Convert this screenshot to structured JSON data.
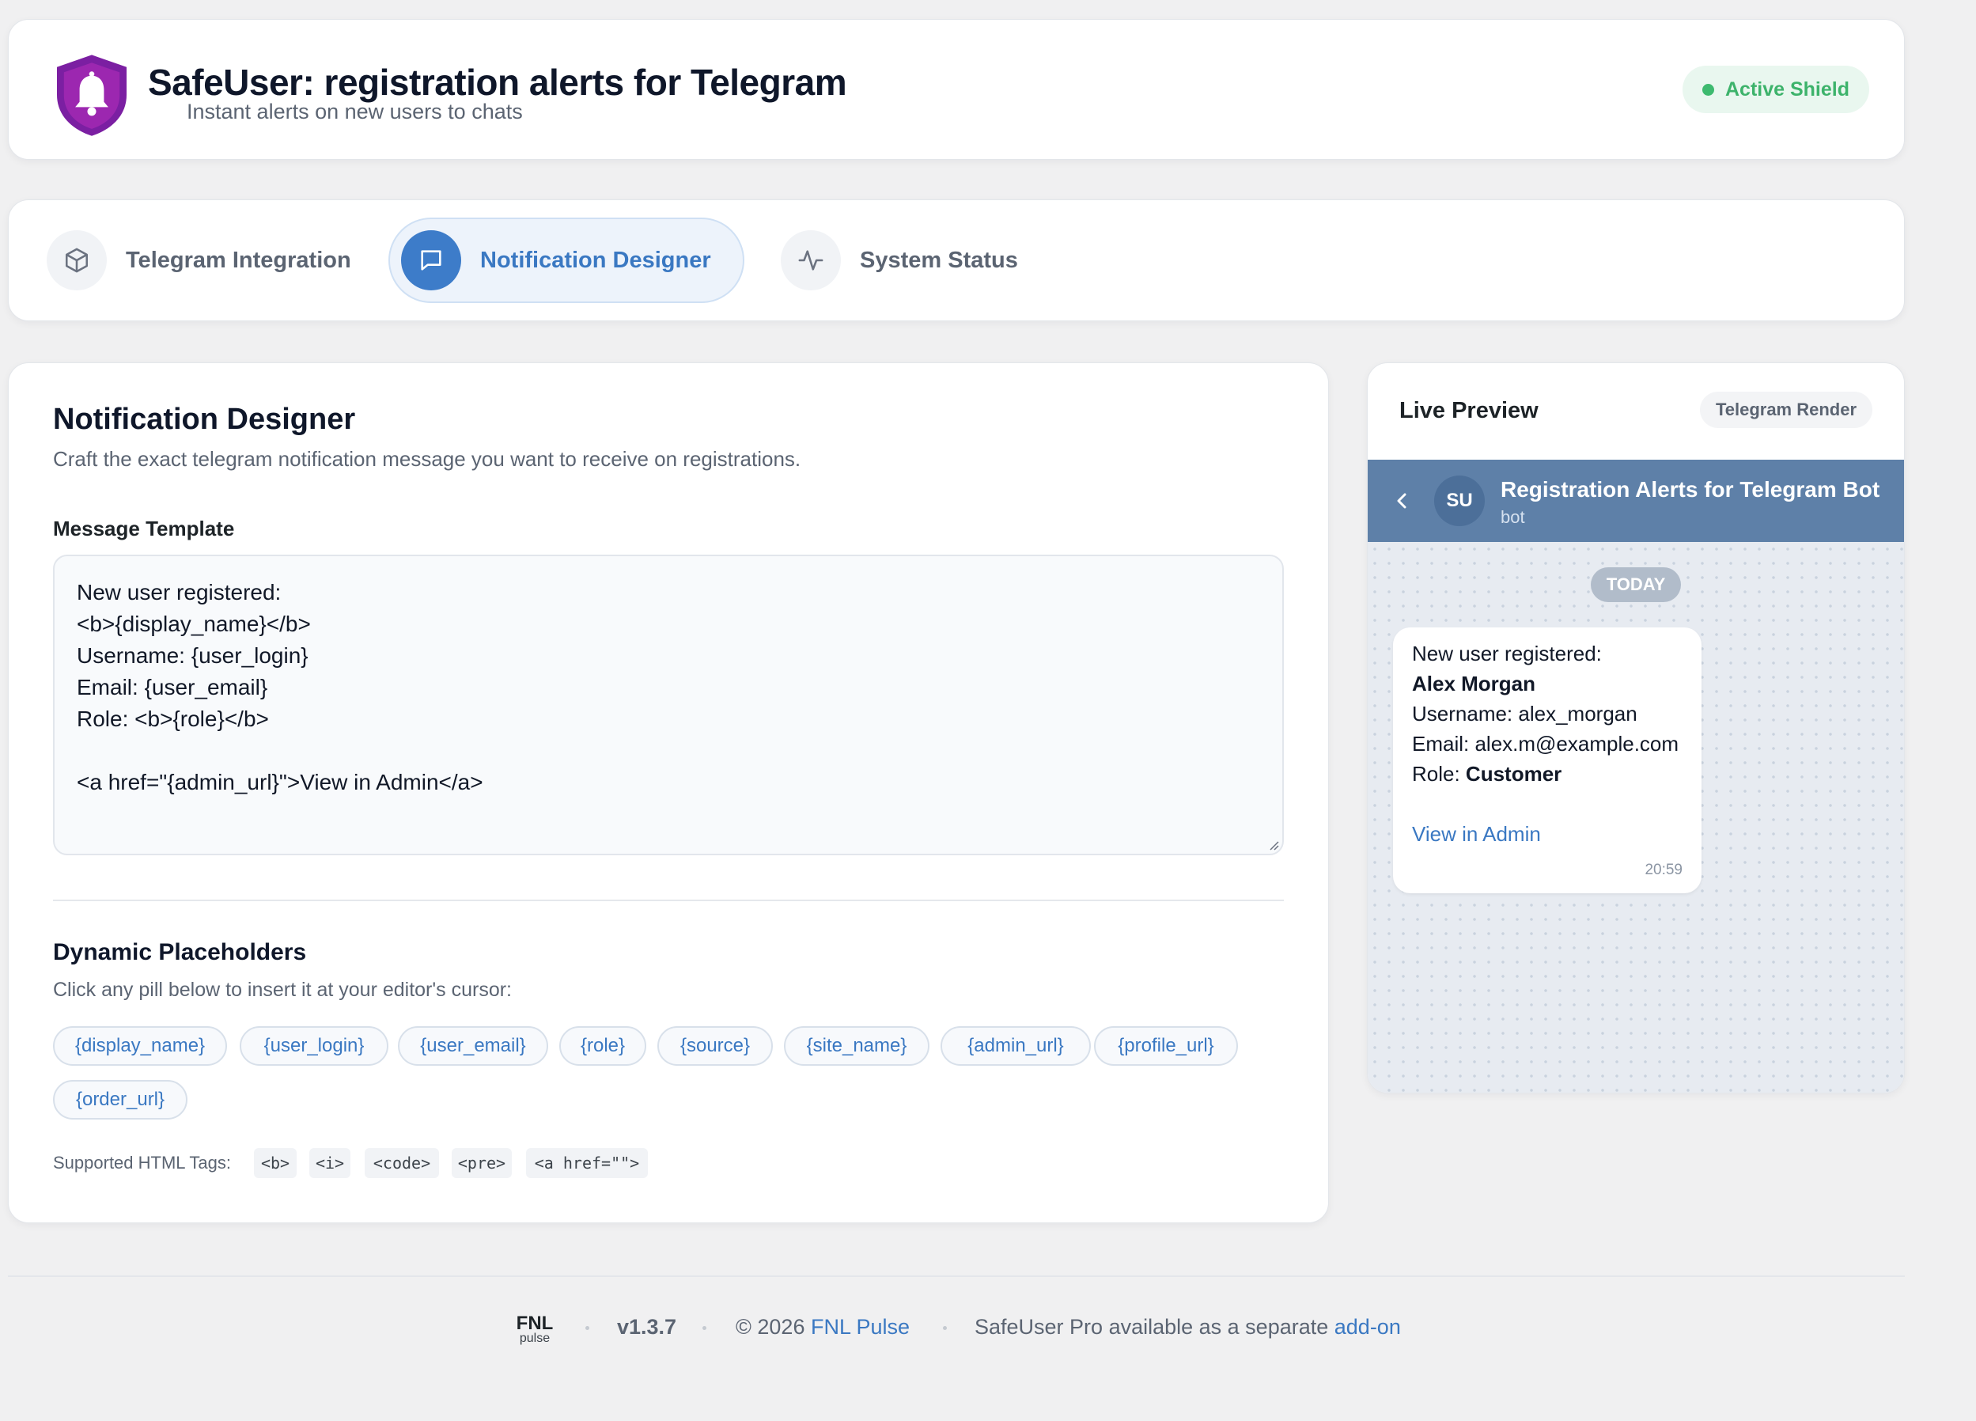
{
  "header": {
    "title": "SafeUser: registration alerts for Telegram",
    "subtitle": "Instant alerts on new users to chats",
    "status_badge": "Active Shield",
    "logo_icon": "shield-bell-icon",
    "brand_color": "#7b1fa2"
  },
  "tabs": [
    {
      "label": "Telegram Integration",
      "icon": "cube-icon",
      "active": false
    },
    {
      "label": "Notification Designer",
      "icon": "chat-bubble-icon",
      "active": true
    },
    {
      "label": "System Status",
      "icon": "activity-icon",
      "active": false
    }
  ],
  "designer": {
    "title": "Notification Designer",
    "description": "Craft the exact telegram notification message you want to receive on registrations.",
    "template_label": "Message Template",
    "template_lines": [
      "New user registered:",
      "<b>{display_name}</b>",
      "Username: {user_login}",
      "Email: {user_email}",
      "Role: <b>{role}</b>",
      "",
      "<a href=\"{admin_url}\">View in Admin</a>"
    ],
    "placeholders_title": "Dynamic Placeholders",
    "placeholders_hint": "Click any pill below to insert it at your editor's cursor:",
    "placeholders": [
      "{display_name}",
      "{user_login}",
      "{user_email}",
      "{role}",
      "{source}",
      "{site_name}",
      "{admin_url}",
      "{profile_url}",
      "{order_url}"
    ],
    "supported_tags_label": "Supported HTML Tags:",
    "supported_tags": [
      "<b>",
      "<i>",
      "<code>",
      "<pre>",
      "<a href=\"\">"
    ]
  },
  "preview": {
    "title": "Live Preview",
    "badge": "Telegram Render",
    "bot_avatar": "SU",
    "bot_name": "Registration Alerts for Telegram Bot",
    "bot_status": "bot",
    "day_label": "TODAY",
    "message": {
      "line1": "New user registered:",
      "name": "Alex Morgan",
      "username": "Username: alex_morgan",
      "email": "Email: alex.m@example.com",
      "role_prefix": "Role: ",
      "role": "Customer",
      "link": "View in Admin",
      "time": "20:59"
    }
  },
  "footer": {
    "logo_top": "FNL",
    "logo_bottom": "pulse",
    "version": "v1.3.7",
    "copyright_prefix": "© 2026 ",
    "copyright_link": "FNL Pulse",
    "promo_prefix": "SafeUser Pro available as a separate ",
    "promo_link": "add-on"
  },
  "colors": {
    "accent": "#3a78c2",
    "success": "#3db36b",
    "telegram_header": "#5e80a8"
  }
}
